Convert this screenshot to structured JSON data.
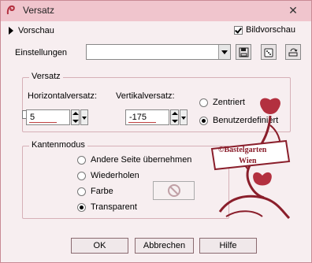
{
  "window": {
    "title": "Versatz"
  },
  "preview": {
    "label": "Vorschau"
  },
  "bildvorschau": {
    "label": "Bildvorschau",
    "checked": true
  },
  "einstellungen": {
    "label": "Einstellungen",
    "value": ""
  },
  "versatz": {
    "legend": "Versatz",
    "horizontal": {
      "label": "Horizontalversatz:",
      "value": "5"
    },
    "vertical": {
      "label": "Vertikalversatz:",
      "value": "-175"
    },
    "options": [
      {
        "label": "Zentriert",
        "selected": false
      },
      {
        "label": "Benutzerdefiniert",
        "selected": true
      }
    ]
  },
  "kantenmodus": {
    "legend": "Kantenmodus",
    "options": [
      {
        "label": "Andere Seite übernehmen",
        "selected": false
      },
      {
        "label": "Wiederholen",
        "selected": false
      },
      {
        "label": "Farbe",
        "selected": false
      },
      {
        "label": "Transparent",
        "selected": true
      }
    ]
  },
  "watermark": {
    "line1": "©Bastelgarten",
    "line2": "Wien"
  },
  "buttons": {
    "ok": "OK",
    "cancel": "Abbrechen",
    "help": "Hilfe"
  },
  "colors": {
    "accent": "#b3303f",
    "titlebar": "#f0c5cd",
    "background": "#f7eef0"
  }
}
